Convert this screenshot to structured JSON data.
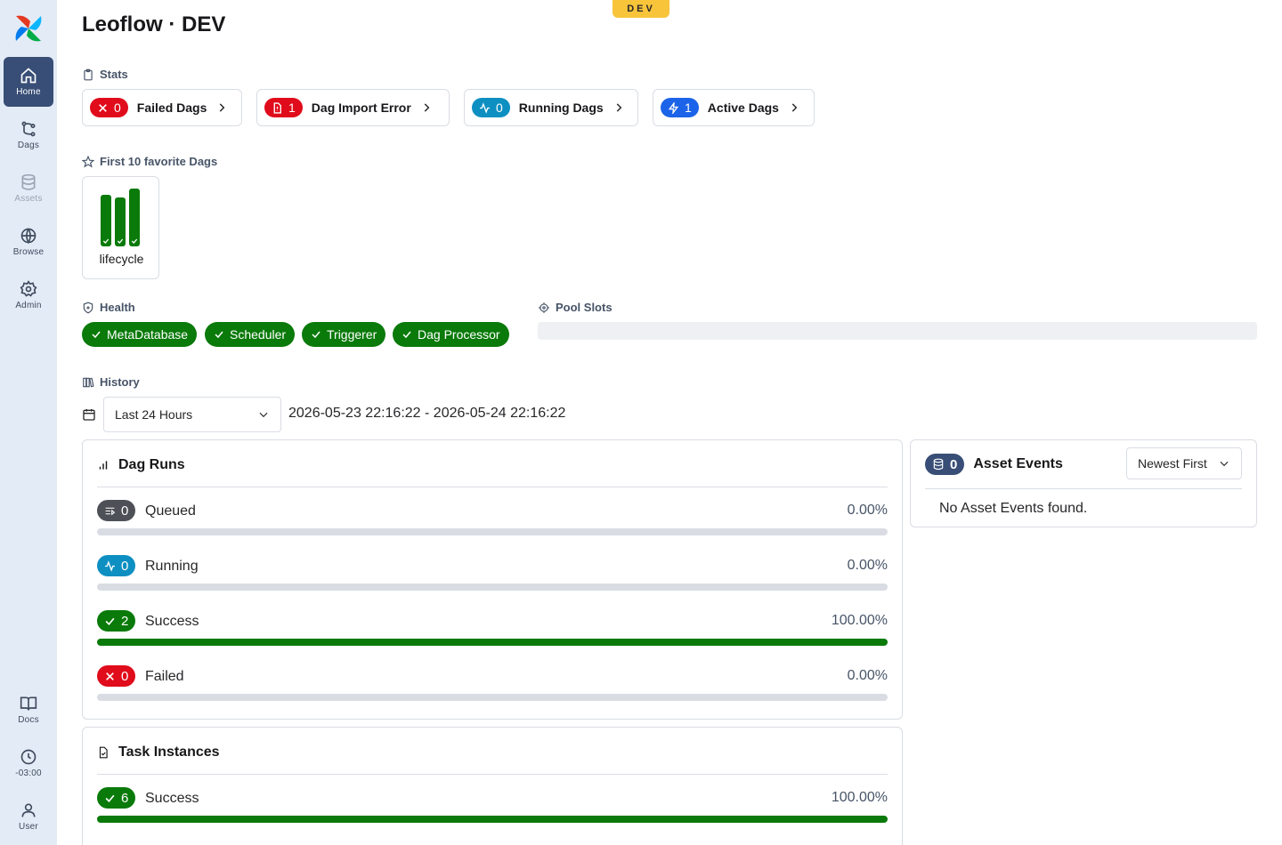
{
  "env_badge": "DEV",
  "page_title": "Leoflow · DEV",
  "sidebar": {
    "items": [
      {
        "label": "Home",
        "icon": "home-icon",
        "active": true
      },
      {
        "label": "Dags",
        "icon": "dags-icon"
      },
      {
        "label": "Assets",
        "icon": "database-icon",
        "disabled": true
      },
      {
        "label": "Browse",
        "icon": "globe-icon"
      },
      {
        "label": "Admin",
        "icon": "gear-icon"
      }
    ],
    "bottom": [
      {
        "label": "Docs",
        "icon": "book-icon"
      },
      {
        "label": "-03:00",
        "icon": "clock-icon"
      },
      {
        "label": "User",
        "icon": "user-icon"
      }
    ]
  },
  "stats": {
    "heading": "Stats",
    "cards": [
      {
        "count": "0",
        "label": "Failed Dags",
        "color": "#e00b1b"
      },
      {
        "count": "1",
        "label": "Dag Import Error",
        "color": "#e00b1b"
      },
      {
        "count": "0",
        "label": "Running Dags",
        "color": "#0e8fc1"
      },
      {
        "count": "1",
        "label": "Active Dags",
        "color": "#1b63e8"
      }
    ]
  },
  "favorites": {
    "heading": "First 10 favorite Dags",
    "dags": [
      {
        "name": "lifecycle",
        "recent_runs": [
          "success",
          "success",
          "success"
        ]
      }
    ]
  },
  "health": {
    "heading": "Health",
    "components": [
      "MetaDatabase",
      "Scheduler",
      "Triggerer",
      "Dag Processor"
    ]
  },
  "pool_slots": {
    "heading": "Pool Slots"
  },
  "history": {
    "heading": "History",
    "range_select": "Last 24 Hours",
    "range_text": "2026-05-23 22:16:22 - 2026-05-24 22:16:22"
  },
  "dag_runs": {
    "title": "Dag Runs",
    "rows": [
      {
        "state": "Queued",
        "count": "0",
        "percent": "0.00%",
        "fraction": 0,
        "color": "#4d5056"
      },
      {
        "state": "Running",
        "count": "0",
        "percent": "0.00%",
        "fraction": 0,
        "color": "#0e8fc1"
      },
      {
        "state": "Success",
        "count": "2",
        "percent": "100.00%",
        "fraction": 1,
        "color": "#0a7a0a"
      },
      {
        "state": "Failed",
        "count": "0",
        "percent": "0.00%",
        "fraction": 0,
        "color": "#e00b1b"
      }
    ]
  },
  "task_instances": {
    "title": "Task Instances",
    "rows": [
      {
        "state": "Success",
        "count": "6",
        "percent": "100.00%",
        "fraction": 1,
        "color": "#0a7a0a"
      }
    ]
  },
  "asset_events": {
    "title": "Asset Events",
    "count": "0",
    "sort": "Newest First",
    "empty_text": "No Asset Events found."
  }
}
